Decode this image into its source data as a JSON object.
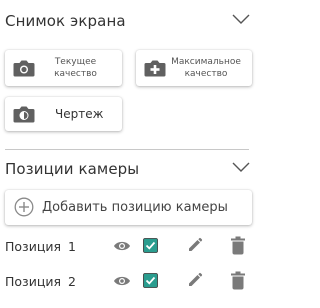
{
  "screenshot_section": {
    "title": "Снимок экрана",
    "buttons": [
      {
        "icon": "camera-icon",
        "label": "Текущее качество"
      },
      {
        "icon": "camera-plus-icon",
        "label": "Максимальное качество"
      },
      {
        "icon": "camera-flip-icon",
        "label": "Чертеж"
      }
    ]
  },
  "camera_positions_section": {
    "title": "Позиции камеры",
    "add_button_label": "Добавить позицию камеры",
    "positions": [
      {
        "label": "Позиция",
        "number": "1",
        "visible": true,
        "checked": true
      },
      {
        "label": "Позиция",
        "number": "2",
        "visible": true,
        "checked": true
      }
    ]
  },
  "colors": {
    "checkbox_fill": "#2a9d8f",
    "icon_gray": "#7a7a7a",
    "camera_dark": "#606060",
    "divider": "#c8c8c8"
  }
}
